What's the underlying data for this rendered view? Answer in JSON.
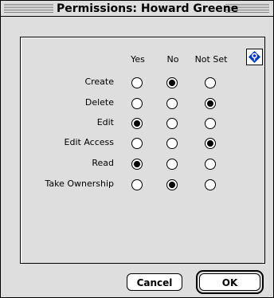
{
  "window": {
    "title": "Permissions: Howard Greene"
  },
  "columns": [
    "Yes",
    "No",
    "Not Set"
  ],
  "rows": [
    {
      "label": "Create",
      "selected": 1
    },
    {
      "label": "Delete",
      "selected": 2
    },
    {
      "label": "Edit",
      "selected": 0
    },
    {
      "label": "Edit Access",
      "selected": 2
    },
    {
      "label": "Read",
      "selected": 0
    },
    {
      "label": "Take Ownership",
      "selected": 1
    }
  ],
  "buttons": {
    "cancel": "Cancel",
    "ok": "OK"
  },
  "colors": {
    "help_icon": "#0033cc",
    "window_bg": "#dedede"
  },
  "icons": {
    "help": "balloon-help-icon"
  }
}
